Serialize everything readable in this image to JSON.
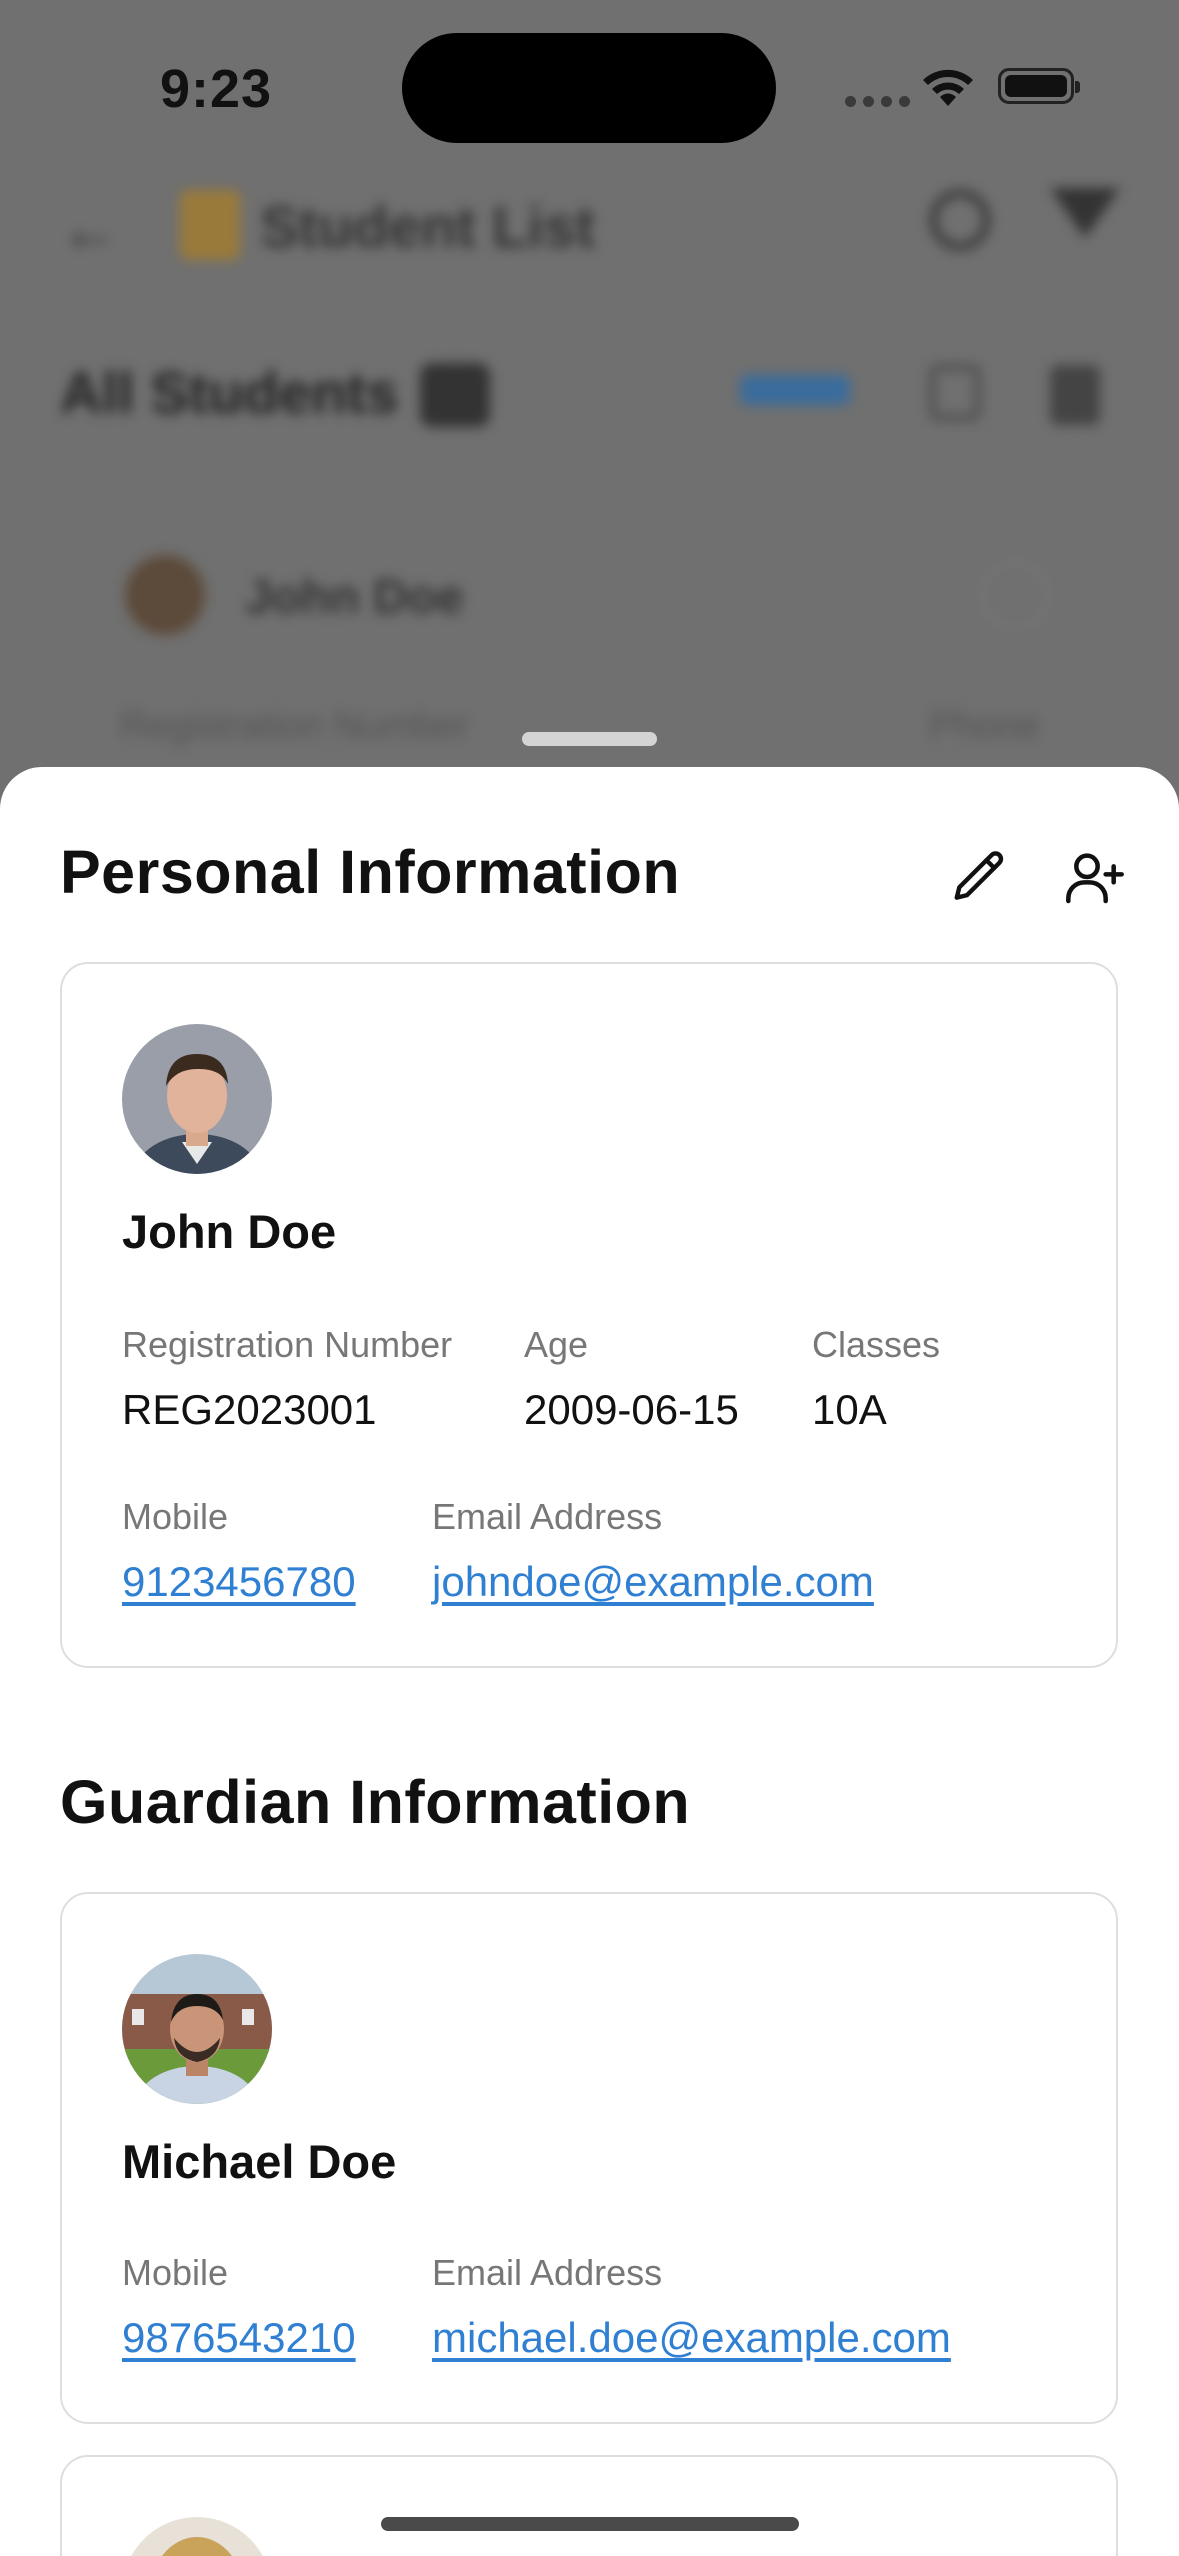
{
  "status_bar": {
    "time": "9:23"
  },
  "background": {
    "nav_title": "Student List",
    "heading": "All Students",
    "first_row_name": "John Doe",
    "first_row_label": "Registration Number",
    "first_row_label_right": "Phone"
  },
  "sheet": {
    "personal_title": "Personal Information",
    "guardian_title": "Guardian Information",
    "student": {
      "name": "John Doe",
      "registration_label": "Registration Number",
      "registration_value": "REG2023001",
      "age_label": "Age",
      "age_value": "2009-06-15",
      "classes_label": "Classes",
      "classes_value": "10A",
      "mobile_label": "Mobile",
      "mobile_value": "9123456780",
      "email_label": "Email Address",
      "email_value": "johndoe@example.com"
    },
    "guardian": {
      "name": "Michael Doe",
      "mobile_label": "Mobile",
      "mobile_value": "9876543210",
      "email_label": "Email Address",
      "email_value": "michael.doe@example.com"
    }
  },
  "icons": {
    "edit": "pencil-icon",
    "add_guardian": "user-plus-icon"
  },
  "colors": {
    "link": "#2f7fd3",
    "text": "#111111",
    "label": "#777777"
  }
}
